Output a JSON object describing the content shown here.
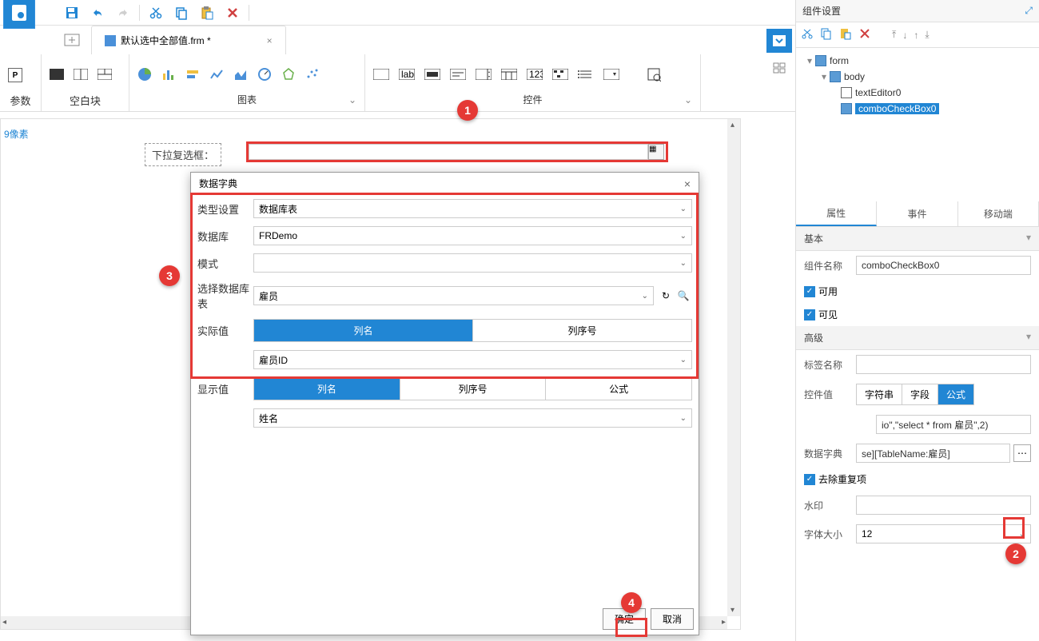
{
  "toolbar": {
    "icons": [
      "save",
      "undo",
      "redo",
      "cut",
      "copy",
      "paste",
      "delete"
    ]
  },
  "tab": {
    "title": "默认选中全部值.frm *",
    "close": "×"
  },
  "ribbon": {
    "group_param": "参数",
    "group_blank": "空白块",
    "group_chart": "图表",
    "group_widget": "控件"
  },
  "canvas": {
    "ruler_label": "9像素",
    "combo_label": "下拉复选框："
  },
  "dialog": {
    "title": "数据字典",
    "close": "×",
    "type_label": "类型设置",
    "type_value": "数据库表",
    "db_label": "数据库",
    "db_value": "FRDemo",
    "schema_label": "模式",
    "schema_value": "",
    "table_label": "选择数据库表",
    "table_value": "雇员",
    "actual_label": "实际值",
    "actual_seg1": "列名",
    "actual_seg2": "列序号",
    "actual_value": "雇员ID",
    "display_label": "显示值",
    "display_seg1": "列名",
    "display_seg2": "列序号",
    "display_seg3": "公式",
    "display_value": "姓名",
    "ok": "确定",
    "cancel": "取消"
  },
  "right_panel": {
    "title": "组件设置",
    "tree": {
      "form": "form",
      "body": "body",
      "text_editor": "textEditor0",
      "combo": "comboCheckBox0"
    },
    "tabs": {
      "attr": "属性",
      "event": "事件",
      "mobile": "移动端"
    },
    "sections": {
      "basic": "基本",
      "advanced": "高级"
    },
    "props": {
      "name_label": "组件名称",
      "name_value": "comboCheckBox0",
      "enabled": "可用",
      "visible": "可见",
      "tag_label": "标签名称",
      "tag_value": "",
      "widget_value_label": "控件值",
      "wv_string": "字符串",
      "wv_field": "字段",
      "wv_formula": "公式",
      "widget_value_text": "io\",\"select * from 雇员\",2)",
      "dict_label": "数据字典",
      "dict_value": "se][TableName:雇员]",
      "dedup": "去除重复项",
      "watermark_label": "水印",
      "watermark_value": "",
      "font_size_label": "字体大小",
      "font_size_value": "12"
    }
  },
  "callouts": {
    "c1": "1",
    "c2": "2",
    "c3": "3",
    "c4": "4"
  }
}
